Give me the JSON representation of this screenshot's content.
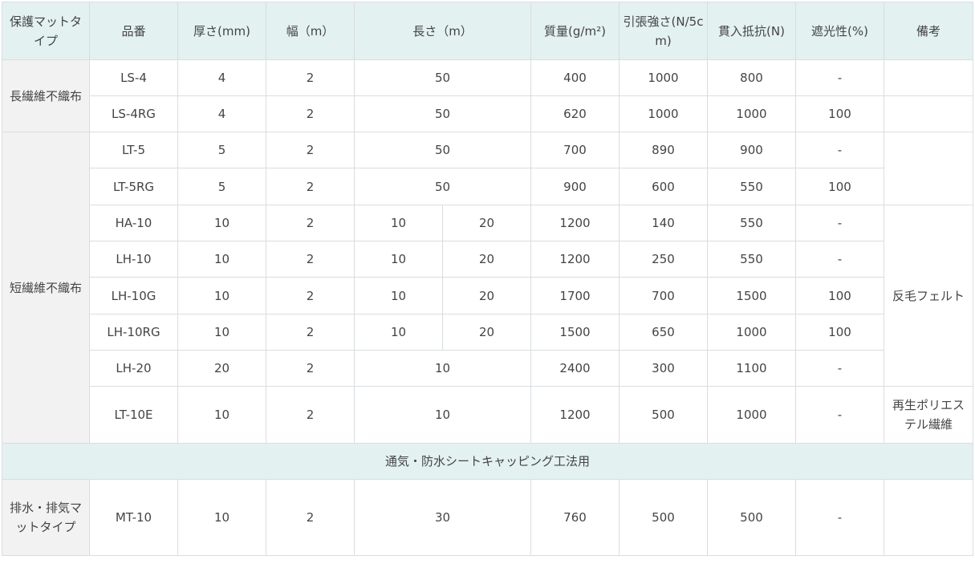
{
  "headers": {
    "type": "保護マットタイプ",
    "code": "品番",
    "thickness": "厚さ(mm)",
    "width": "幅（m）",
    "length": "長さ（m）",
    "mass": "質量(g/m²)",
    "tensile": "引張強さ(N/5cm)",
    "penetration": "貫入抵抗(N)",
    "shading": "遮光性(%)",
    "remarks": "備考"
  },
  "groups": {
    "long_fiber": "長繊維不織布",
    "short_fiber": "短繊維不織布",
    "drain": "排水・排気マットタイプ"
  },
  "section_title": "通気・防水シートキャッピング工法用",
  "remarks": {
    "felt": "反毛フェルト",
    "recycled": "再生ポリエステル繊維"
  },
  "rows": [
    {
      "code": "LS-4",
      "thickness": "4",
      "width": "2",
      "length": "50",
      "mass": "400",
      "tensile": "1000",
      "penetration": "800",
      "shading": "-"
    },
    {
      "code": "LS-4RG",
      "thickness": "4",
      "width": "2",
      "length": "50",
      "mass": "620",
      "tensile": "1000",
      "penetration": "1000",
      "shading": "100"
    },
    {
      "code": "LT-5",
      "thickness": "5",
      "width": "2",
      "length": "50",
      "mass": "700",
      "tensile": "890",
      "penetration": "900",
      "shading": "-"
    },
    {
      "code": "LT-5RG",
      "thickness": "5",
      "width": "2",
      "length": "50",
      "mass": "900",
      "tensile": "600",
      "penetration": "550",
      "shading": "100"
    },
    {
      "code": "HA-10",
      "thickness": "10",
      "width": "2",
      "length_a": "10",
      "length_b": "20",
      "mass": "1200",
      "tensile": "140",
      "penetration": "550",
      "shading": "-"
    },
    {
      "code": "LH-10",
      "thickness": "10",
      "width": "2",
      "length_a": "10",
      "length_b": "20",
      "mass": "1200",
      "tensile": "250",
      "penetration": "550",
      "shading": "-"
    },
    {
      "code": "LH-10G",
      "thickness": "10",
      "width": "2",
      "length_a": "10",
      "length_b": "20",
      "mass": "1700",
      "tensile": "700",
      "penetration": "1500",
      "shading": "100"
    },
    {
      "code": "LH-10RG",
      "thickness": "10",
      "width": "2",
      "length_a": "10",
      "length_b": "20",
      "mass": "1500",
      "tensile": "650",
      "penetration": "1000",
      "shading": "100"
    },
    {
      "code": "LH-20",
      "thickness": "20",
      "width": "2",
      "length": "10",
      "mass": "2400",
      "tensile": "300",
      "penetration": "1100",
      "shading": "-"
    },
    {
      "code": "LT-10E",
      "thickness": "10",
      "width": "2",
      "length": "10",
      "mass": "1200",
      "tensile": "500",
      "penetration": "1000",
      "shading": "-"
    },
    {
      "code": "MT-10",
      "thickness": "10",
      "width": "2",
      "length": "30",
      "mass": "760",
      "tensile": "500",
      "penetration": "500",
      "shading": "-"
    }
  ]
}
